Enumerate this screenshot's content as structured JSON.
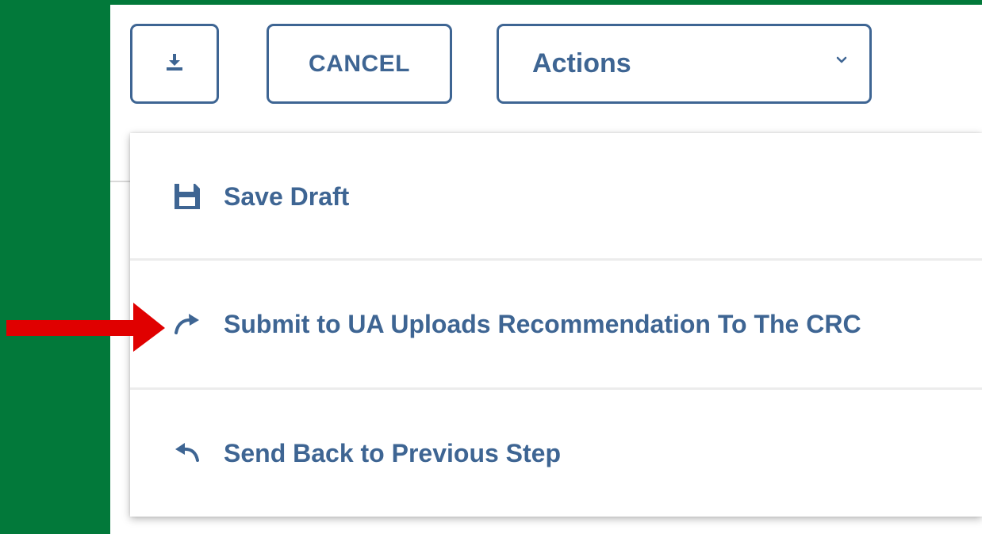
{
  "toolbar": {
    "download_icon": "download-icon",
    "cancel_label": "CANCEL",
    "actions_label": "Actions",
    "actions_chevron_icon": "chevron-down-icon"
  },
  "menu": {
    "items": [
      {
        "label": "Save Draft",
        "icon": "save-icon"
      },
      {
        "label": "Submit to UA Uploads Recommendation To The CRC",
        "icon": "redo-arrow-icon"
      },
      {
        "label": "Send Back to Previous Step",
        "icon": "undo-arrow-icon"
      }
    ]
  },
  "annotation": {
    "arrow_color": "#e00000",
    "points_to": "menu.items.1"
  },
  "colors": {
    "background_green": "#02793a",
    "accent_blue": "#3e6593",
    "panel": "#ffffff"
  }
}
